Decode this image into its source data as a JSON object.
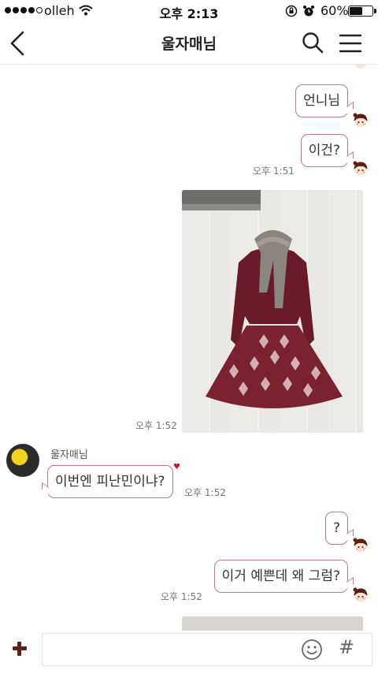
{
  "status_bar": {
    "carrier": "olleh",
    "time": "오후 2:13",
    "battery": "60%",
    "battery_level": 0.6
  },
  "header": {
    "title": "울자매님"
  },
  "messages": [
    {
      "side": "right",
      "text": "언니님"
    },
    {
      "side": "right",
      "text": "이건?",
      "time": "오후 1:51"
    },
    {
      "side": "right",
      "type": "image",
      "time": "오후 1:52"
    },
    {
      "side": "left",
      "sender": "울자매님",
      "text": "이번엔 피난민이냐?",
      "time": "오후 1:52"
    },
    {
      "side": "right",
      "text": "?"
    },
    {
      "side": "right",
      "text": "이거 예쁜데 왜 그럼?",
      "time": "오후 1:52"
    },
    {
      "side": "right",
      "type": "image"
    }
  ],
  "input": {
    "value": "",
    "placeholder": ""
  },
  "icons": {
    "back": "chevron-left-icon",
    "search": "search-icon",
    "menu": "hamburger-menu-icon",
    "add": "plus-icon",
    "emoji": "emoji-icon",
    "hashtag": "hash-icon"
  },
  "colors": {
    "bubble_border": "#c9777c",
    "plus_button": "#5a2416",
    "heart": "#dd1122"
  }
}
